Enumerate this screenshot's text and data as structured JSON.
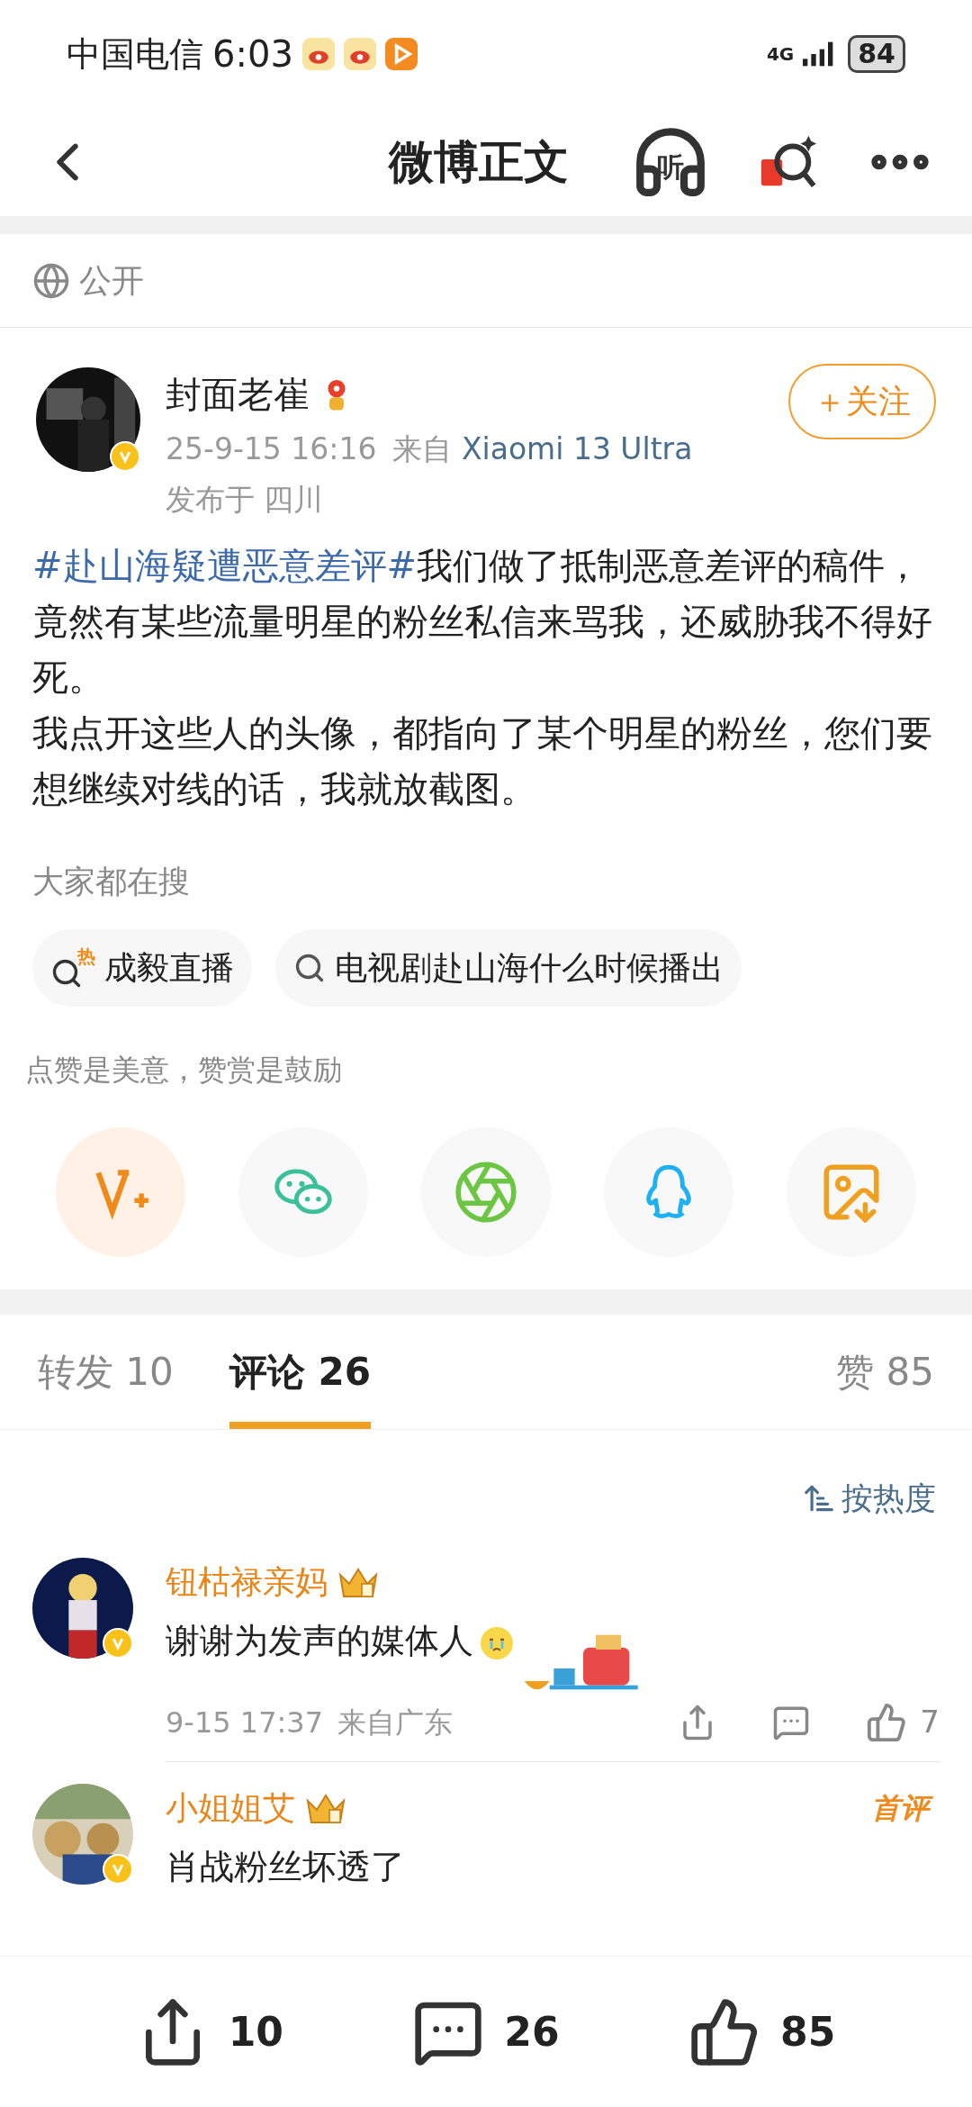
{
  "status_bar": {
    "carrier": "中国电信",
    "time": "6:03",
    "network": "4G",
    "battery": "84"
  },
  "header": {
    "title": "微博正文",
    "listen_label": "听"
  },
  "visibility": "公开",
  "post": {
    "author": "封面老崔",
    "time": "25-9-15 16:16",
    "source_prefix": "来自",
    "device": "Xiaomi 13 Ultra",
    "location": "发布于 四川",
    "follow_label": "＋关注",
    "verified": true,
    "paragraphs": [
      {
        "hashtag": "#赴山海疑遭恶意差评#",
        "text": "我们做了抵制恶意差评的稿件，竟然有某些流量明星的粉丝私信来骂我，还威胁我不得好死。"
      },
      {
        "text": "我点开这些人的头像，都指向了某个明星的粉丝，您们要想继续对线的话，我就放截图。"
      }
    ]
  },
  "searches": {
    "title": "大家都在搜",
    "chips": [
      {
        "label": "成毅直播",
        "hot": true,
        "hot_label": "热"
      },
      {
        "label": "电视剧赴山海什么时候播出",
        "hot": false
      }
    ]
  },
  "reward_tip": "点赞是美意，赞赏是鼓励",
  "share": [
    {
      "kind": "reward"
    },
    {
      "kind": "wechat"
    },
    {
      "kind": "moments"
    },
    {
      "kind": "qq"
    },
    {
      "kind": "save"
    }
  ],
  "tabs": [
    {
      "label": "转发",
      "count": "10",
      "selected": false
    },
    {
      "label": "评论",
      "count": "26",
      "selected": true
    }
  ],
  "likes_tab": {
    "label": "赞",
    "count": "85"
  },
  "sort_label": "按热度",
  "comments": [
    {
      "user": "钮枯禄亲妈",
      "verified": true,
      "text": "谢谢为发声的媒体人",
      "time": "9-15 17:37",
      "location": "来自广东",
      "likes": "7",
      "first": false
    },
    {
      "user": "小姐姐艾",
      "verified": true,
      "text": "肖战粉丝坏透了",
      "first": true,
      "first_label": "首评"
    }
  ],
  "bottom_bar": [
    {
      "kind": "repost",
      "count": "10"
    },
    {
      "kind": "comment",
      "count": "26"
    },
    {
      "kind": "like",
      "count": "85"
    }
  ]
}
